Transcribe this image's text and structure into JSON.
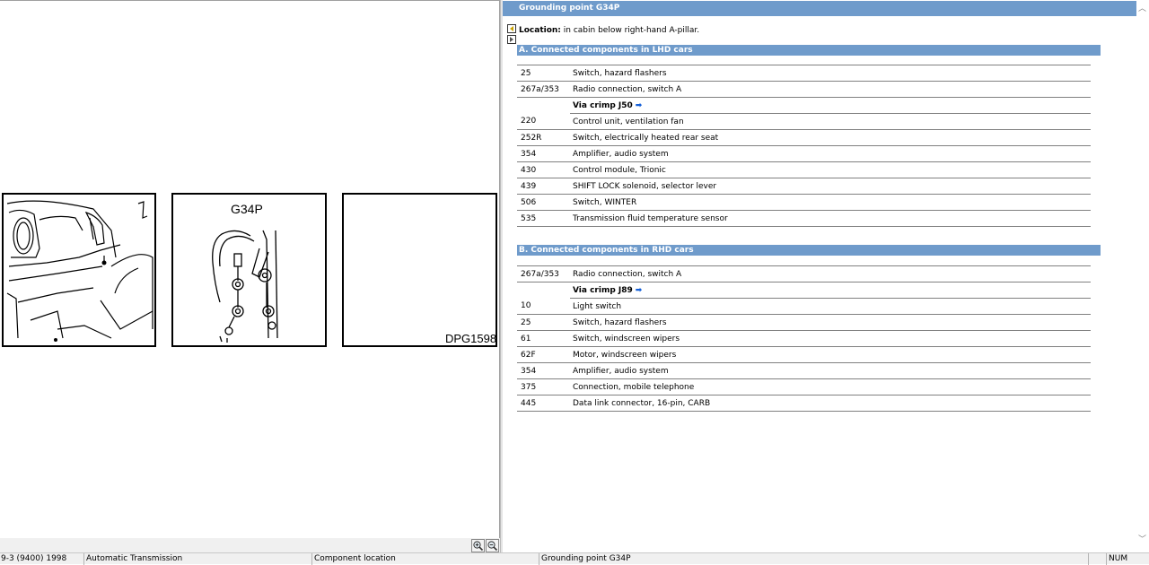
{
  "left_pane": {
    "panels": [
      {
        "label": ""
      },
      {
        "label": "G34P"
      },
      {
        "label": "DPG1598"
      }
    ],
    "zoom_in_icon": "zoom-in-icon",
    "zoom_out_icon": "zoom-out-icon"
  },
  "right_pane": {
    "title": "Grounding point G34P",
    "location_label": "Location:",
    "location_text": "in cabin below right-hand A-pillar.",
    "section_a": {
      "title": "A. Connected components in LHD cars",
      "rows": [
        {
          "code": "25",
          "desc": "Switch, hazard flashers"
        },
        {
          "code": "267a/353",
          "desc": "Radio connection, switch A"
        },
        {
          "code": "",
          "desc": "Via crimp J50",
          "via": true
        },
        {
          "code": "220",
          "desc": "Control unit, ventilation fan"
        },
        {
          "code": "252R",
          "desc": "Switch, electrically heated rear seat"
        },
        {
          "code": "354",
          "desc": "Amplifier, audio system"
        },
        {
          "code": "430",
          "desc": "Control module, Trionic"
        },
        {
          "code": "439",
          "desc": "SHIFT LOCK solenoid, selector lever"
        },
        {
          "code": "506",
          "desc": "Switch, WINTER"
        },
        {
          "code": "535",
          "desc": "Transmission fluid temperature sensor"
        }
      ]
    },
    "section_b": {
      "title": "B. Connected components in RHD cars",
      "rows": [
        {
          "code": "267a/353",
          "desc": "Radio connection, switch A"
        },
        {
          "code": "",
          "desc": "Via crimp J89",
          "via": true
        },
        {
          "code": "10",
          "desc": "Light switch"
        },
        {
          "code": "25",
          "desc": "Switch, hazard flashers"
        },
        {
          "code": "61",
          "desc": "Switch, windscreen wipers"
        },
        {
          "code": "62F",
          "desc": "Motor, windscreen wipers"
        },
        {
          "code": "354",
          "desc": "Amplifier, audio system"
        },
        {
          "code": "375",
          "desc": "Connection, mobile telephone"
        },
        {
          "code": "445",
          "desc": "Data link connector, 16-pin, CARB"
        }
      ]
    },
    "via_arrow_glyph": "➡"
  },
  "status_bar": {
    "model": "9-3 (9400) 1998",
    "system": "Automatic Transmission",
    "view": "Component location",
    "item": "Grounding point G34P",
    "blank": "",
    "num": "NUM"
  },
  "colors": {
    "header_blue": "#6f9bcb",
    "link_arrow": "#1560d8"
  }
}
